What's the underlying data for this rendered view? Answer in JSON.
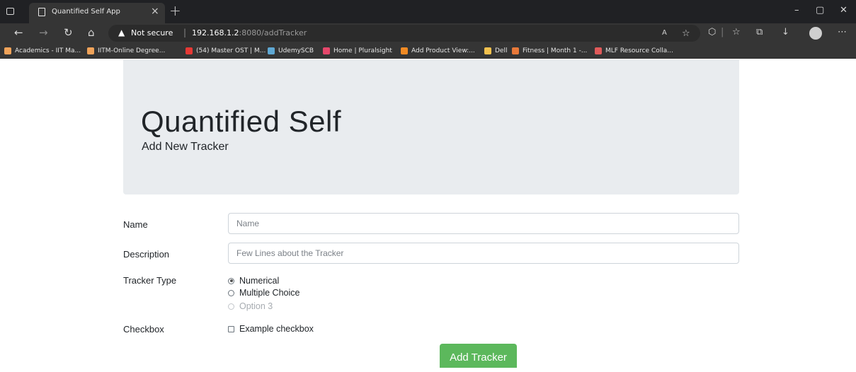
{
  "browser": {
    "tab_title": "Quantified Self App",
    "tab_close": "×",
    "new_tab": "+",
    "security_label": "Not secure",
    "url_host": "192.168.1.2",
    "url_path": ":8080/addTracker",
    "window_controls": [
      "–",
      "▢",
      "✕"
    ],
    "bookmarks": [
      {
        "label": "Academics - IIT Ma...",
        "color": "#f0a35a"
      },
      {
        "label": "IITM-Online Degree...",
        "color": "#f0a35a"
      },
      {
        "label": "(54) Master OST | M...",
        "color": "#e53935"
      },
      {
        "label": "UdemySCB",
        "color": "#5fa8d3"
      },
      {
        "label": "Home | Pluralsight",
        "color": "#e5476b"
      },
      {
        "label": "Add Product View:...",
        "color": "#f08a24"
      },
      {
        "label": "Dell",
        "color": "#f2c14e"
      },
      {
        "label": "Fitness | Month 1 -...",
        "color": "#e8793a"
      },
      {
        "label": "MLF Resource Colla...",
        "color": "#e05a5a"
      }
    ]
  },
  "header": {
    "title": "Quantified Self",
    "subtitle": "Add New Tracker"
  },
  "form": {
    "name_label": "Name",
    "name_placeholder": "Name",
    "description_label": "Description",
    "description_placeholder": "Few Lines about the Tracker",
    "type_label": "Tracker Type",
    "type_options": [
      {
        "label": "Numerical",
        "checked": true,
        "disabled": false
      },
      {
        "label": "Multiple Choice",
        "checked": false,
        "disabled": false
      },
      {
        "label": "Option 3",
        "checked": false,
        "disabled": true
      }
    ],
    "checkbox_label": "Checkbox",
    "checkbox_option": "Example checkbox",
    "submit_label": "Add Tracker"
  },
  "colors": {
    "accent_green": "#5cb85c",
    "jumbotron_bg": "#e9ecef"
  }
}
